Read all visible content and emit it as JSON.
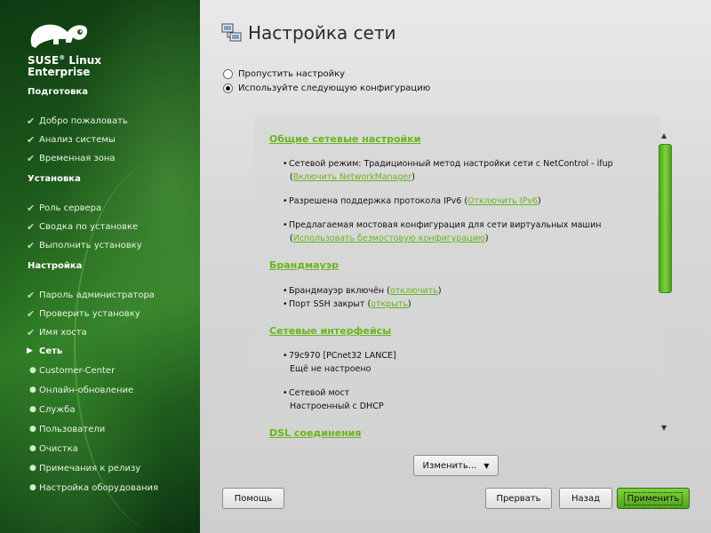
{
  "brand": {
    "line1": "SUSE",
    "reg": "®",
    "line1b": " Linux",
    "line2": "Enterprise"
  },
  "sidebar": {
    "sections": [
      {
        "label": "Подготовка"
      },
      {
        "label": "Установка"
      },
      {
        "label": "Настройка"
      }
    ],
    "items": [
      {
        "label": "Добро пожаловать",
        "state": "done"
      },
      {
        "label": "Анализ системы",
        "state": "done"
      },
      {
        "label": "Временная зона",
        "state": "done"
      },
      {
        "label": "Роль сервера",
        "state": "done"
      },
      {
        "label": "Сводка по установке",
        "state": "done"
      },
      {
        "label": "Выполнить установку",
        "state": "done"
      },
      {
        "label": "Пароль администратора",
        "state": "done"
      },
      {
        "label": "Проверить установку",
        "state": "done"
      },
      {
        "label": "Имя хоста",
        "state": "done"
      },
      {
        "label": "Сеть",
        "state": "current"
      },
      {
        "label": "Customer-Center",
        "state": "pending"
      },
      {
        "label": "Онлайн-обновление",
        "state": "pending"
      },
      {
        "label": "Служба",
        "state": "pending"
      },
      {
        "label": "Пользователи",
        "state": "pending"
      },
      {
        "label": "Очистка",
        "state": "pending"
      },
      {
        "label": "Примечания к релизу",
        "state": "pending"
      },
      {
        "label": "Настройка оборудования",
        "state": "pending"
      }
    ],
    "icons": {
      "done": "checkmark-icon",
      "current": "arrow-right-icon",
      "pending": "bullet-icon"
    }
  },
  "main": {
    "title": "Настройка сети",
    "options": [
      {
        "label": "Пропустить настройку",
        "checked": false
      },
      {
        "label": "Используйте следующую конфигурацию",
        "checked": true
      }
    ],
    "summary": {
      "general_heading": "Общие сетевые настройки",
      "mode_text": "Сетевой режим: Традиционный метод настройки сети с NetControl - ifup",
      "mode_link": "Включить NetworkManager",
      "ipv6_text": "Разрешена поддержка протокола IPv6 (",
      "ipv6_link": "Отключить IPv6",
      "bridge_text": "Предлагаемая мостовая конфигурация для сети виртуальных машин",
      "bridge_link": "Использовать безмостовую конфигурацию",
      "firewall_heading": "Брандмауэр",
      "fw_on_text": "Брандмауэр включён (",
      "fw_on_link": "отключить",
      "ssh_text": "Порт SSH закрыт (",
      "ssh_link": "открыть",
      "interfaces_heading": "Сетевые интерфейсы",
      "if1_name": "79c970 [PCnet32 LANCE]",
      "if1_status": "Ещё не настроено",
      "if2_name": "Сетевой мост",
      "if2_status": "Настроенный с DHCP",
      "cut_heading": "DSL соединения"
    },
    "change_button": "Изменить...",
    "buttons": {
      "help": "Помощь",
      "abort": "Прервать",
      "back": "Назад",
      "apply": "Применить"
    }
  },
  "colors": {
    "accent": "#6ab51e",
    "sidebar": "#1d5a1b"
  }
}
